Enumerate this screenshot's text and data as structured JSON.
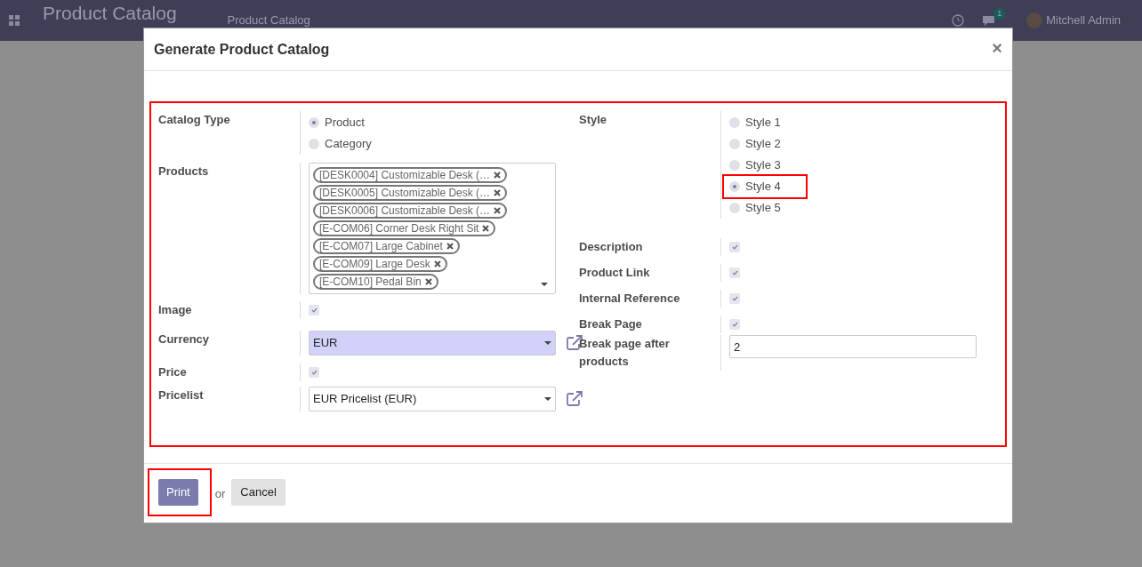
{
  "topbar": {
    "app_title": "Product Catalog",
    "breadcrumb": "Product Catalog",
    "chat_count": "1",
    "user": "Mitchell Admin"
  },
  "dialog": {
    "title": "Generate Product Catalog",
    "close": "×",
    "form_highlighted": true,
    "left_fields": [
      {
        "kind": "radio",
        "label": "Catalog Type",
        "options": [
          {
            "label": "Product",
            "selected": true,
            "highlighted": false
          },
          {
            "label": "Category",
            "selected": false,
            "highlighted": false
          }
        ]
      },
      {
        "kind": "tags",
        "label": "Products",
        "tags": [
          "[DESK0004] Customizable Desk (…",
          "[DESK0005] Customizable Desk (…",
          "[DESK0006] Customizable Desk (…",
          "[E-COM06] Corner Desk Right Sit",
          "[E-COM07] Large Cabinet",
          "[E-COM09] Large Desk",
          "[E-COM10] Pedal Bin"
        ]
      },
      {
        "kind": "checkbox",
        "label": "Image",
        "checked": true
      },
      {
        "kind": "select",
        "label": "Currency",
        "value": "EUR",
        "focused": true
      },
      {
        "kind": "checkbox",
        "label": "Price",
        "checked": true
      },
      {
        "kind": "select",
        "label": "Pricelist",
        "value": "EUR Pricelist (EUR)",
        "focused": false
      }
    ],
    "right_fields": [
      {
        "kind": "radio",
        "label": "Style",
        "options": [
          {
            "label": "Style 1",
            "selected": false,
            "highlighted": false
          },
          {
            "label": "Style 2",
            "selected": false,
            "highlighted": false
          },
          {
            "label": "Style 3",
            "selected": false,
            "highlighted": false
          },
          {
            "label": "Style 4",
            "selected": true,
            "highlighted": true
          },
          {
            "label": "Style 5",
            "selected": false,
            "highlighted": false
          }
        ]
      },
      {
        "kind": "checkbox",
        "label": "Description",
        "checked": true
      },
      {
        "kind": "checkbox",
        "label": "Product Link",
        "checked": true
      },
      {
        "kind": "checkbox",
        "label": "Internal Reference",
        "checked": true
      },
      {
        "kind": "checkbox",
        "label": "Break Page",
        "checked": true
      },
      {
        "kind": "input",
        "label": "Break page after products",
        "value": "2"
      }
    ],
    "footer": {
      "primary": "Print",
      "primary_highlighted": true,
      "separator": "or",
      "secondary": "Cancel"
    }
  }
}
